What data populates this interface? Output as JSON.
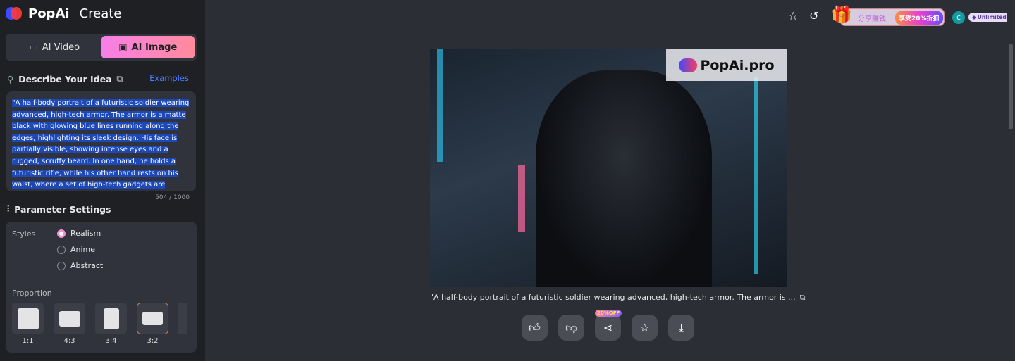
{
  "header": {
    "brand": "PopAi",
    "title": "Create"
  },
  "modes": [
    {
      "label": "AI Video",
      "icon": "video-icon",
      "active": false
    },
    {
      "label": "AI Image",
      "icon": "image-icon",
      "active": true
    }
  ],
  "describe": {
    "title": "Describe Your Idea",
    "examples": "Examples",
    "prompt": "\"A half-body portrait of a futuristic soldier wearing advanced, high-tech armor. The armor is a matte black with glowing blue lines running along the edges, highlighting its sleek design. His face is partially visible, showing intense eyes and a rugged, scruffy beard. In one hand, he holds a futuristic rifle, while his other hand rests on his waist, where a set of high-tech gadgets are attached. The background is a",
    "counter": "504 / 1000"
  },
  "params": {
    "title": "Parameter Settings",
    "styles_label": "Styles",
    "styles": [
      {
        "label": "Realism",
        "selected": true
      },
      {
        "label": "Anime",
        "selected": false
      },
      {
        "label": "Abstract",
        "selected": false
      }
    ],
    "proportion_label": "Proportion",
    "proportions": [
      {
        "label": "1:1",
        "selected": false
      },
      {
        "label": "4:3",
        "selected": false
      },
      {
        "label": "3:4",
        "selected": false
      },
      {
        "label": "3:2",
        "selected": true
      }
    ]
  },
  "topbar": {
    "promo_text": "分享赚钱",
    "promo_badge": "享受20%折扣",
    "avatar": "C",
    "plan": "Unlimited"
  },
  "result": {
    "watermark": "PopAi.pro",
    "caption": "\"A half-body portrait of a futuristic soldier wearing advanced, high-tech armor. The armor is ...",
    "share_badge": "20%OFF"
  },
  "colors": {
    "accent": "#f77fe8",
    "link": "#4c7dff"
  }
}
